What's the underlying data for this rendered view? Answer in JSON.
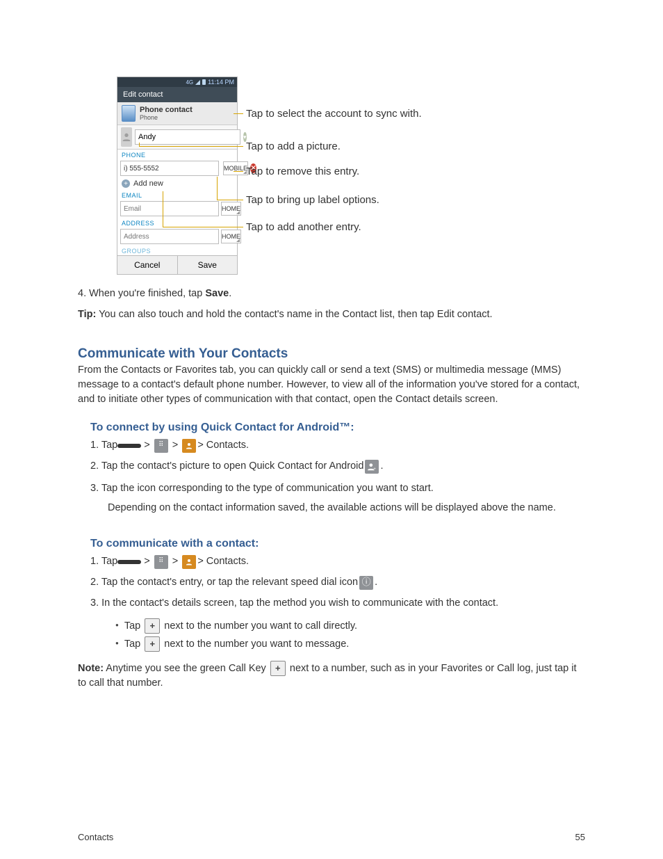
{
  "phone": {
    "status_time": "11:14 PM",
    "title": "Edit contact",
    "account": {
      "type": "Phone contact",
      "sub": "Phone"
    },
    "name_value": "Andy",
    "sections": {
      "phone": "PHONE",
      "email": "EMAIL",
      "address": "ADDRESS",
      "groups": "GROUPS"
    },
    "phone_row": {
      "number": "i) 555-5552",
      "label": "MOBILE"
    },
    "add_new": "Add new",
    "email_row": {
      "placeholder": "Email",
      "label": "HOME"
    },
    "address_row": {
      "placeholder": "Address",
      "label": "HOME"
    },
    "buttons": {
      "cancel": "Cancel",
      "save": "Save"
    }
  },
  "callouts": {
    "c1": "Tap to select the account to sync with.",
    "c2": "Tap to add a picture.",
    "c3": "Tap to remove this entry.",
    "c4": "Tap to bring up label options.",
    "c5": "Tap to add another entry."
  },
  "doc": {
    "step4": "4.   When you're finished, tap ",
    "save_word": "Save",
    "tip_label": "Tip:",
    "tip_text": " You can also touch and hold the contact's name in the Contact list, then tap Edit contact.",
    "speed_head": "Communicate with Your Contacts",
    "speed_intro": "From the Contacts or Favorites tab, you can quickly call or send a text (SMS) or multimedia message (MMS) message to a contact's default phone number. However, to view all of the information you've stored for a contact, and to initiate other types of communication with that contact, open the Contact details screen.",
    "speed_sub": "To connect by using Quick Contact for Android™:",
    "speed_1a": "1.   Tap ",
    "speed_1b": " > Contacts.",
    "speed_2": "2.   Tap the contact's picture to open Quick Contact for Android ",
    "speed_3": "3.   Tap the icon corresponding to the type of communication you want to start.",
    "speed_note": "Depending on the contact information saved, the available actions will be displayed above the name.",
    "comm_sub": "To communicate with a contact:",
    "comm_1a": "1.   Tap ",
    "comm_1b": " > Contacts.",
    "comm_2": "2.   Tap the contact's entry, or tap the relevant speed dial icon ",
    "comm_3": "3.   In the contact's details screen, tap the method you wish to communicate with the contact.",
    "bul1_a": "Tap ",
    "bul1_b": " next to the number you want to call directly.",
    "bul2_a": "Tap ",
    "bul2_b": " next to the number you want to message.",
    "note_label": "Note:",
    "note_text": " Anytime you see the green Call Key ",
    "note_text2": " next to a number, such as in your Favorites or Call log, just tap it to call that number.",
    "footer_left": "Contacts",
    "footer_right": "55"
  }
}
